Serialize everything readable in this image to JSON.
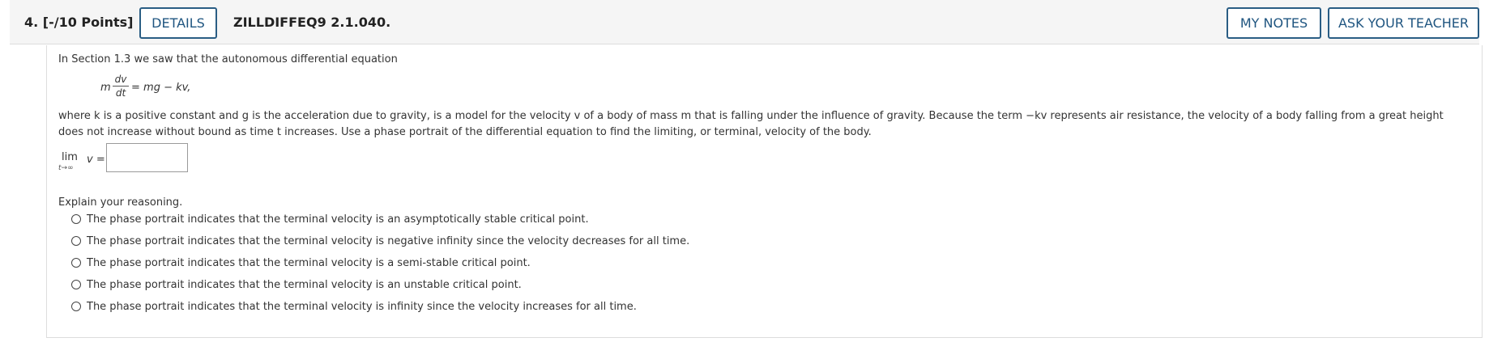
{
  "header": {
    "question": "4. [-/10 Points]",
    "details_label": "DETAILS",
    "assignment_id": "ZILLDIFFEQ9 2.1.040.",
    "my_notes_label": "MY NOTES",
    "ask_teacher_label": "ASK YOUR TEACHER"
  },
  "content": {
    "intro": "In Section 1.3 we saw that the autonomous differential equation",
    "equation": {
      "lhs_m": "m",
      "num": "dv",
      "den": "dt",
      "rhs": "= mg − kv,"
    },
    "para_line1": "where k is a positive constant and g is the acceleration due to gravity, is a model for the velocity v of a body of mass m that is falling under the influence of gravity. Because the term −kv represents air resistance, the velocity of a body falling from a great height",
    "para_line2": "does not increase without bound as time t increases. Use a phase portrait of the differential equation to find the limiting, or terminal, velocity of the body.",
    "limit": {
      "lim": "lim",
      "sub": "t→∞",
      "expr": "v ="
    },
    "answer_value": "",
    "explain_label": "Explain your reasoning.",
    "options": [
      "The phase portrait indicates that the terminal velocity is an asymptotically stable critical point.",
      "The phase portrait indicates that the terminal velocity is negative infinity since the velocity decreases for all time.",
      "The phase portrait indicates that the terminal velocity is a semi-stable critical point.",
      "The phase portrait indicates that the terminal velocity is an unstable critical point.",
      "The phase portrait indicates that the terminal velocity is infinity since the velocity increases for all time."
    ]
  }
}
